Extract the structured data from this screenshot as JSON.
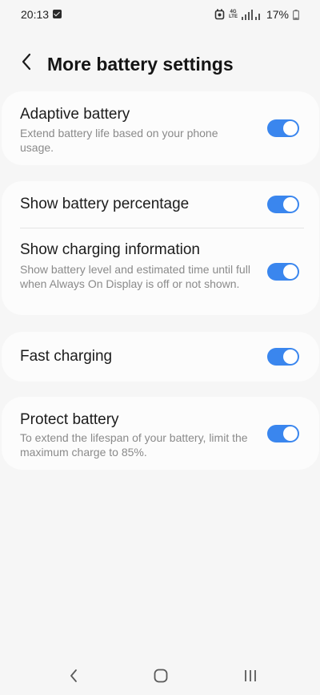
{
  "status_bar": {
    "time": "20:13",
    "network_top": "4G",
    "network_bottom": "LTE",
    "battery_text": "17%",
    "icons": [
      "notification-check-icon",
      "alarm-icon",
      "signal-icon",
      "battery-icon"
    ]
  },
  "header": {
    "back_icon": "back-arrow-icon",
    "title": "More battery settings"
  },
  "settings": {
    "adaptive_battery": {
      "title": "Adaptive battery",
      "subtitle": "Extend battery life based on your phone usage.",
      "enabled": true
    },
    "show_battery_percentage": {
      "title": "Show battery percentage",
      "enabled": true
    },
    "show_charging_information": {
      "title": "Show charging information",
      "subtitle": "Show battery level and estimated time until full when Always On Display is off or not shown.",
      "enabled": true
    },
    "fast_charging": {
      "title": "Fast charging",
      "enabled": true
    },
    "protect_battery": {
      "title": "Protect battery",
      "subtitle": "To extend the lifespan of your battery, limit the maximum charge to 85%.",
      "enabled": true
    }
  },
  "colors": {
    "background": "#f6f6f6",
    "card": "#fcfcfc",
    "toggle_on": "#3a86ee",
    "subtitle_text": "#8a8a8a"
  },
  "nav_bar": {
    "icons": [
      "nav-back-icon",
      "nav-home-icon",
      "nav-recents-icon"
    ]
  }
}
